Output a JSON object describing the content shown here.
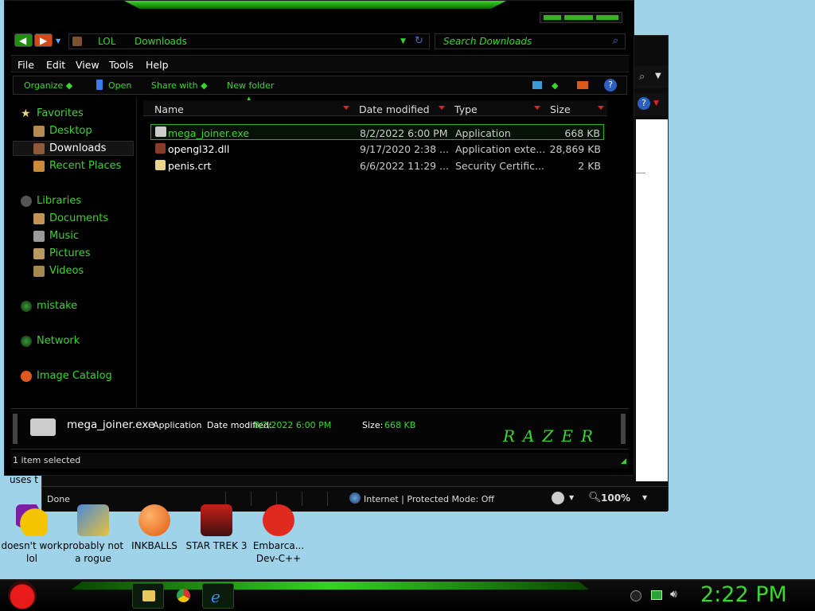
{
  "explorer": {
    "address_parts": [
      "LOL",
      "Downloads"
    ],
    "search_placeholder": "Search Downloads",
    "menu": [
      "File",
      "Edit",
      "View",
      "Tools",
      "Help"
    ],
    "toolbar": {
      "organize": "Organize",
      "open": "Open",
      "share_with": "Share with",
      "new_folder": "New folder"
    },
    "nav": [
      {
        "label": "Favorites",
        "icon": "star-icon"
      },
      {
        "label": "Desktop",
        "icon": "desktop-icon"
      },
      {
        "label": "Downloads",
        "icon": "downloads-icon"
      },
      {
        "label": "Recent Places",
        "icon": "recent-places-icon"
      },
      {
        "label": "Libraries",
        "icon": "libraries-icon"
      },
      {
        "label": "Documents",
        "icon": "documents-icon"
      },
      {
        "label": "Music",
        "icon": "music-icon"
      },
      {
        "label": "Pictures",
        "icon": "pictures-icon"
      },
      {
        "label": "Videos",
        "icon": "videos-icon"
      },
      {
        "label": "mistake",
        "icon": "homegroup-icon"
      },
      {
        "label": "Network",
        "icon": "network-icon"
      },
      {
        "label": "Image Catalog",
        "icon": "image-catalog-icon"
      }
    ],
    "columns": [
      "Name",
      "Date modified",
      "Type",
      "Size"
    ],
    "files": [
      {
        "name": "mega_joiner.exe",
        "date": "8/2/2022 6:00 PM",
        "type": "Application",
        "size": "668 KB",
        "selected": true
      },
      {
        "name": "opengl32.dll",
        "date": "9/17/2020 2:38 ...",
        "type": "Application exte...",
        "size": "28,869 KB",
        "selected": false
      },
      {
        "name": "penis.crt",
        "date": "6/6/2022 11:29 ...",
        "type": "Security Certific...",
        "size": "2 KB",
        "selected": false
      }
    ],
    "details": {
      "name": "mega_joiner.exe",
      "type": "Application",
      "date_label": "Date modified:",
      "date_value": "8/2/2022 6:00 PM",
      "size_label": "Size:",
      "size_value": "668 KB",
      "logo_text": "RAZER"
    },
    "status": "1 item selected"
  },
  "ie": {
    "status_left": "Done",
    "zone": "Internet | Protected Mode: Off",
    "zoom": "100%",
    "partial_text": "uses t"
  },
  "desktop_icons": [
    {
      "label": "doesn't work lol",
      "icon": "yahoo-messenger-icon"
    },
    {
      "label": "probably not a rogue",
      "icon": "setup-gears-icon"
    },
    {
      "label": "INKBALLS",
      "icon": "inkball-icon"
    },
    {
      "label": "STAR TREK 3",
      "icon": "star-trek-icon"
    },
    {
      "label": "Embarca... Dev-C++",
      "icon": "dev-cpp-icon"
    }
  ],
  "taskbar": {
    "clock": "2:22 PM"
  },
  "colors": {
    "accent": "#37d82b",
    "selection_border": "#2fae1f",
    "desktop": "#9fd3ea"
  }
}
